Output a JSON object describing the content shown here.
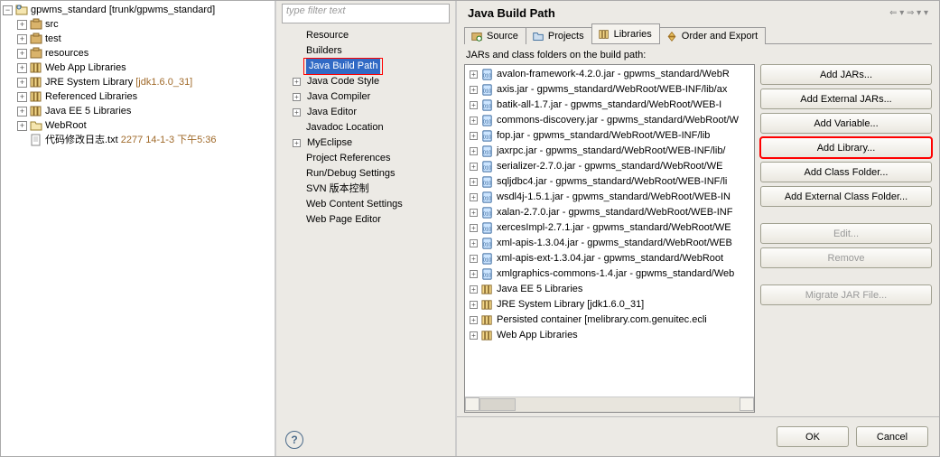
{
  "project_explorer": {
    "root": "gpwms_standard [trunk/gpwms_standard]",
    "nodes": [
      {
        "exp": "+",
        "icon": "pkg",
        "label": "src"
      },
      {
        "exp": "+",
        "icon": "pkg",
        "label": "test"
      },
      {
        "exp": "+",
        "icon": "pkg",
        "label": "resources"
      },
      {
        "exp": "+",
        "icon": "lib",
        "label": "Web App Libraries"
      },
      {
        "exp": "+",
        "icon": "lib",
        "label": "JRE System Library ",
        "meta": "[jdk1.6.0_31]"
      },
      {
        "exp": "+",
        "icon": "lib",
        "label": "Referenced Libraries"
      },
      {
        "exp": "+",
        "icon": "lib",
        "label": "Java EE 5 Libraries"
      },
      {
        "exp": "+",
        "icon": "fld",
        "label": "WebRoot"
      },
      {
        "exp": " ",
        "icon": "file",
        "label": "代码修改日志.txt ",
        "meta": "2277  14-1-3 下午5:36"
      }
    ]
  },
  "filter_placeholder": "type filter text",
  "prop_tree": [
    {
      "d": 0,
      "exp": "",
      "label": "Resource"
    },
    {
      "d": 0,
      "exp": "",
      "label": "Builders"
    },
    {
      "d": 0,
      "exp": "",
      "label": "Java Build Path",
      "sel": true,
      "hl": true
    },
    {
      "d": 0,
      "exp": "+",
      "label": "Java Code Style"
    },
    {
      "d": 0,
      "exp": "+",
      "label": "Java Compiler"
    },
    {
      "d": 0,
      "exp": "+",
      "label": "Java Editor"
    },
    {
      "d": 0,
      "exp": "",
      "label": "Javadoc Location"
    },
    {
      "d": 0,
      "exp": "+",
      "label": "MyEclipse"
    },
    {
      "d": 0,
      "exp": "",
      "label": "Project References"
    },
    {
      "d": 0,
      "exp": "",
      "label": "Run/Debug Settings"
    },
    {
      "d": 0,
      "exp": "",
      "label": "SVN 版本控制"
    },
    {
      "d": 0,
      "exp": "",
      "label": "Web Content Settings"
    },
    {
      "d": 0,
      "exp": "",
      "label": "Web Page Editor"
    }
  ],
  "page_title": "Java Build Path",
  "nav_hint": "⇐ ▾ ⇒ ▾ ▾",
  "tabs": [
    {
      "icon": "src",
      "label": "Source"
    },
    {
      "icon": "prj",
      "label": "Projects"
    },
    {
      "icon": "lib",
      "label": "Libraries",
      "active": true
    },
    {
      "icon": "ord",
      "label": "Order and Export"
    }
  ],
  "subtitle": "JARs and class folders on the build path:",
  "jars": [
    {
      "icon": "jar",
      "text": "avalon-framework-4.2.0.jar - gpwms_standard/WebR"
    },
    {
      "icon": "jar",
      "text": "axis.jar - gpwms_standard/WebRoot/WEB-INF/lib/ax"
    },
    {
      "icon": "jar",
      "text": "batik-all-1.7.jar - gpwms_standard/WebRoot/WEB-I"
    },
    {
      "icon": "jar",
      "text": "commons-discovery.jar - gpwms_standard/WebRoot/W"
    },
    {
      "icon": "jar",
      "text": "fop.jar - gpwms_standard/WebRoot/WEB-INF/lib"
    },
    {
      "icon": "jar",
      "text": "jaxrpc.jar - gpwms_standard/WebRoot/WEB-INF/lib/"
    },
    {
      "icon": "jar",
      "text": "serializer-2.7.0.jar - gpwms_standard/WebRoot/WE"
    },
    {
      "icon": "jar",
      "text": "sqljdbc4.jar - gpwms_standard/WebRoot/WEB-INF/li"
    },
    {
      "icon": "jar",
      "text": "wsdl4j-1.5.1.jar - gpwms_standard/WebRoot/WEB-IN"
    },
    {
      "icon": "jar",
      "text": "xalan-2.7.0.jar - gpwms_standard/WebRoot/WEB-INF"
    },
    {
      "icon": "jar",
      "text": "xercesImpl-2.7.1.jar - gpwms_standard/WebRoot/WE"
    },
    {
      "icon": "jar",
      "text": "xml-apis-1.3.04.jar - gpwms_standard/WebRoot/WEB"
    },
    {
      "icon": "jar",
      "text": "xml-apis-ext-1.3.04.jar - gpwms_standard/WebRoot"
    },
    {
      "icon": "jar",
      "text": "xmlgraphics-commons-1.4.jar - gpwms_standard/Web"
    },
    {
      "icon": "lib",
      "text": "Java EE 5 Libraries"
    },
    {
      "icon": "lib",
      "text": "JRE System Library [jdk1.6.0_31]"
    },
    {
      "icon": "lib",
      "text": "Persisted container [melibrary.com.genuitec.ecli"
    },
    {
      "icon": "lib",
      "text": "Web App Libraries"
    }
  ],
  "buttons": {
    "add_jars": "Add JARs...",
    "add_ext_jars": "Add External JARs...",
    "add_var": "Add Variable...",
    "add_lib": "Add Library...",
    "add_cls": "Add Class Folder...",
    "add_ext_cls": "Add External Class Folder...",
    "edit": "Edit...",
    "remove": "Remove",
    "migrate": "Migrate JAR File..."
  },
  "footer": {
    "ok": "OK",
    "cancel": "Cancel"
  }
}
